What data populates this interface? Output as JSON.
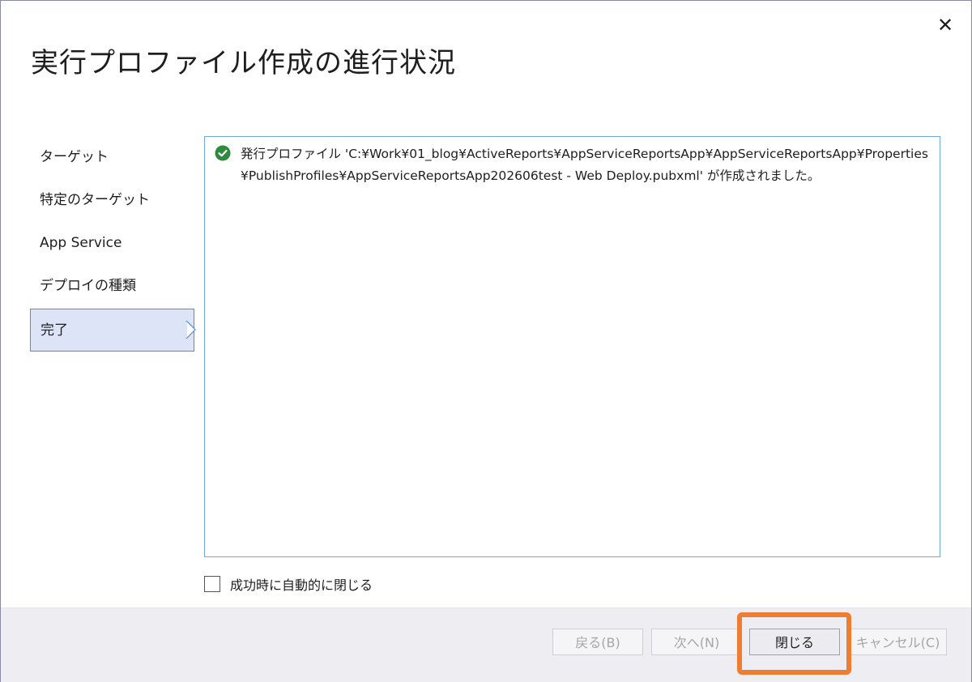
{
  "window": {
    "title": "実行プロファイル作成の進行状況",
    "close_glyph": "✕"
  },
  "nav": {
    "items": [
      {
        "label": "ターゲット"
      },
      {
        "label": "特定のターゲット"
      },
      {
        "label": "App Service"
      },
      {
        "label": "デプロイの種類"
      },
      {
        "label": "完了",
        "active": true
      }
    ]
  },
  "output": {
    "status_icon": "success-check-icon",
    "message": "発行プロファイル 'C:¥Work¥01_blog¥ActiveReports¥AppServiceReportsApp¥AppServiceReportsApp¥Properties¥PublishProfiles¥AppServiceReportsApp202606test - Web Deploy.pubxml' が作成されました。"
  },
  "auto_close": {
    "label": "成功時に自動的に閉じる",
    "checked": false
  },
  "buttons": {
    "back": "戻る(B)",
    "next": "次へ(N)",
    "close": "閉じる",
    "cancel": "キャンセル(C)"
  },
  "colors": {
    "accent_border": "#4a90d9",
    "active_nav_bg": "#dde4f8",
    "success_green": "#2e8b3d",
    "highlight": "#ed7d31"
  }
}
